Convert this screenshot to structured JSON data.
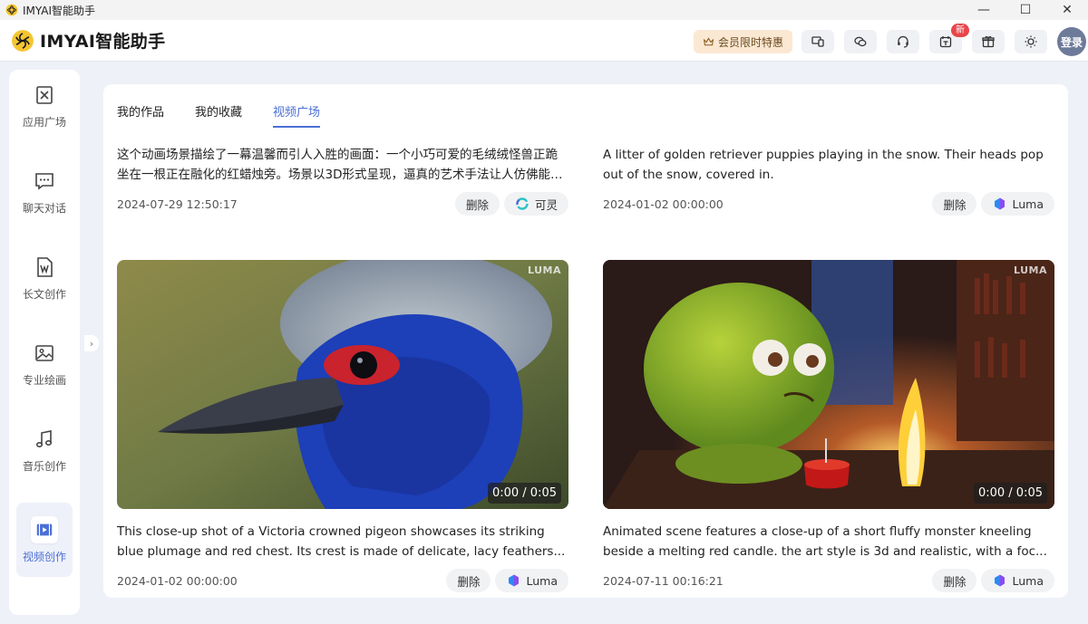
{
  "window": {
    "title": "IMYAI智能助手",
    "minimize": "—",
    "maximize": "☐",
    "close": "✕"
  },
  "header": {
    "logo_text": "IMYAI智能助手",
    "vip_label": "会员限时特惠",
    "new_badge": "新",
    "login_label": "登录"
  },
  "sidebar": {
    "items": [
      {
        "label": "应用广场",
        "icon": "app-store-icon"
      },
      {
        "label": "聊天对话",
        "icon": "chat-icon"
      },
      {
        "label": "长文创作",
        "icon": "word-doc-icon"
      },
      {
        "label": "专业绘画",
        "icon": "image-icon"
      },
      {
        "label": "音乐创作",
        "icon": "music-note-icon"
      },
      {
        "label": "视频创作",
        "icon": "video-icon"
      }
    ],
    "active_index": 5,
    "collapse_glyph": "›"
  },
  "tabs": [
    {
      "label": "我的作品"
    },
    {
      "label": "我的收藏"
    },
    {
      "label": "视频广场"
    }
  ],
  "active_tab": 2,
  "cards": [
    {
      "description": "这个动画场景描绘了一幕温馨而引人入胜的画面：一个小巧可爱的毛绒绒怪兽正跪坐在一根正在融化的红蜡烛旁。场景以3D形式呈现，逼真的艺术手法让人仿佛能感受...",
      "date": "2024-07-29 12:50:17",
      "delete_label": "删除",
      "model": "可灵"
    },
    {
      "description": "A litter of golden retriever puppies playing in the snow. Their heads pop out of the snow, covered in.",
      "date": "2024-01-02 00:00:00",
      "delete_label": "删除",
      "model": "Luma"
    },
    {
      "description": "This close-up shot of a Victoria crowned pigeon showcases its striking blue plumage and red chest. Its crest is made of delicate, lacy feathers...",
      "date": "2024-01-02 00:00:00",
      "delete_label": "删除",
      "model": "Luma",
      "watermark": "LUMA",
      "duration": "0:00 / 0:05"
    },
    {
      "description": "Animated scene features a close-up of a short fluffy monster kneeling beside a melting red candle. the art style is 3d and realistic, with a foc...",
      "date": "2024-07-11 00:16:21",
      "delete_label": "删除",
      "model": "Luma",
      "watermark": "LUMA",
      "duration": "0:00 / 0:05"
    }
  ],
  "colors": {
    "accent": "#4b6fd6",
    "vip_bg": "#fbe8d3",
    "badge": "#e8454a"
  }
}
